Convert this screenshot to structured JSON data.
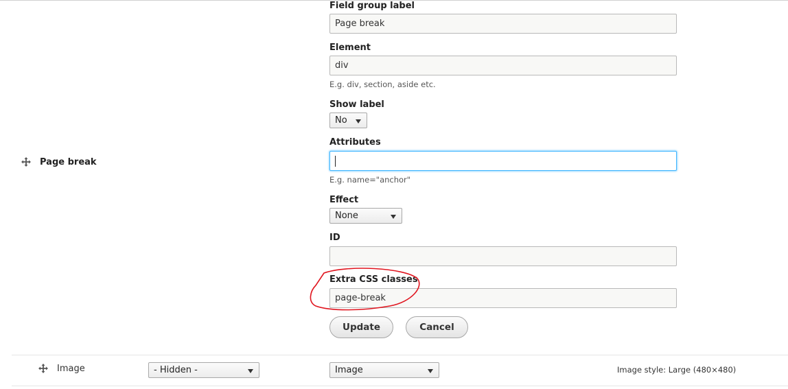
{
  "page_break_row": {
    "title": "Page break",
    "handle_icon": "move-cross-icon"
  },
  "form": {
    "field_group_label": {
      "label": "Field group label",
      "value": "Page break"
    },
    "element": {
      "label": "Element",
      "value": "div",
      "description": "E.g. div, section, aside etc."
    },
    "show_label": {
      "label": "Show label",
      "selected": "No"
    },
    "attributes": {
      "label": "Attributes",
      "value": "",
      "description": "E.g. name=\"anchor\""
    },
    "effect": {
      "label": "Effect",
      "selected": "None"
    },
    "id": {
      "label": "ID",
      "value": ""
    },
    "extra_css_classes": {
      "label": "Extra CSS classes",
      "value": "page-break"
    },
    "update_label": "Update",
    "cancel_label": "Cancel"
  },
  "image_row": {
    "label": "Image",
    "handle_icon": "move-cross-icon",
    "label_display": "- Hidden -",
    "formatter": "Image",
    "summary": "Image style: Large (480×480)"
  },
  "annotation": {
    "shape": "hand-drawn-ellipse",
    "color": "#e0141e"
  }
}
